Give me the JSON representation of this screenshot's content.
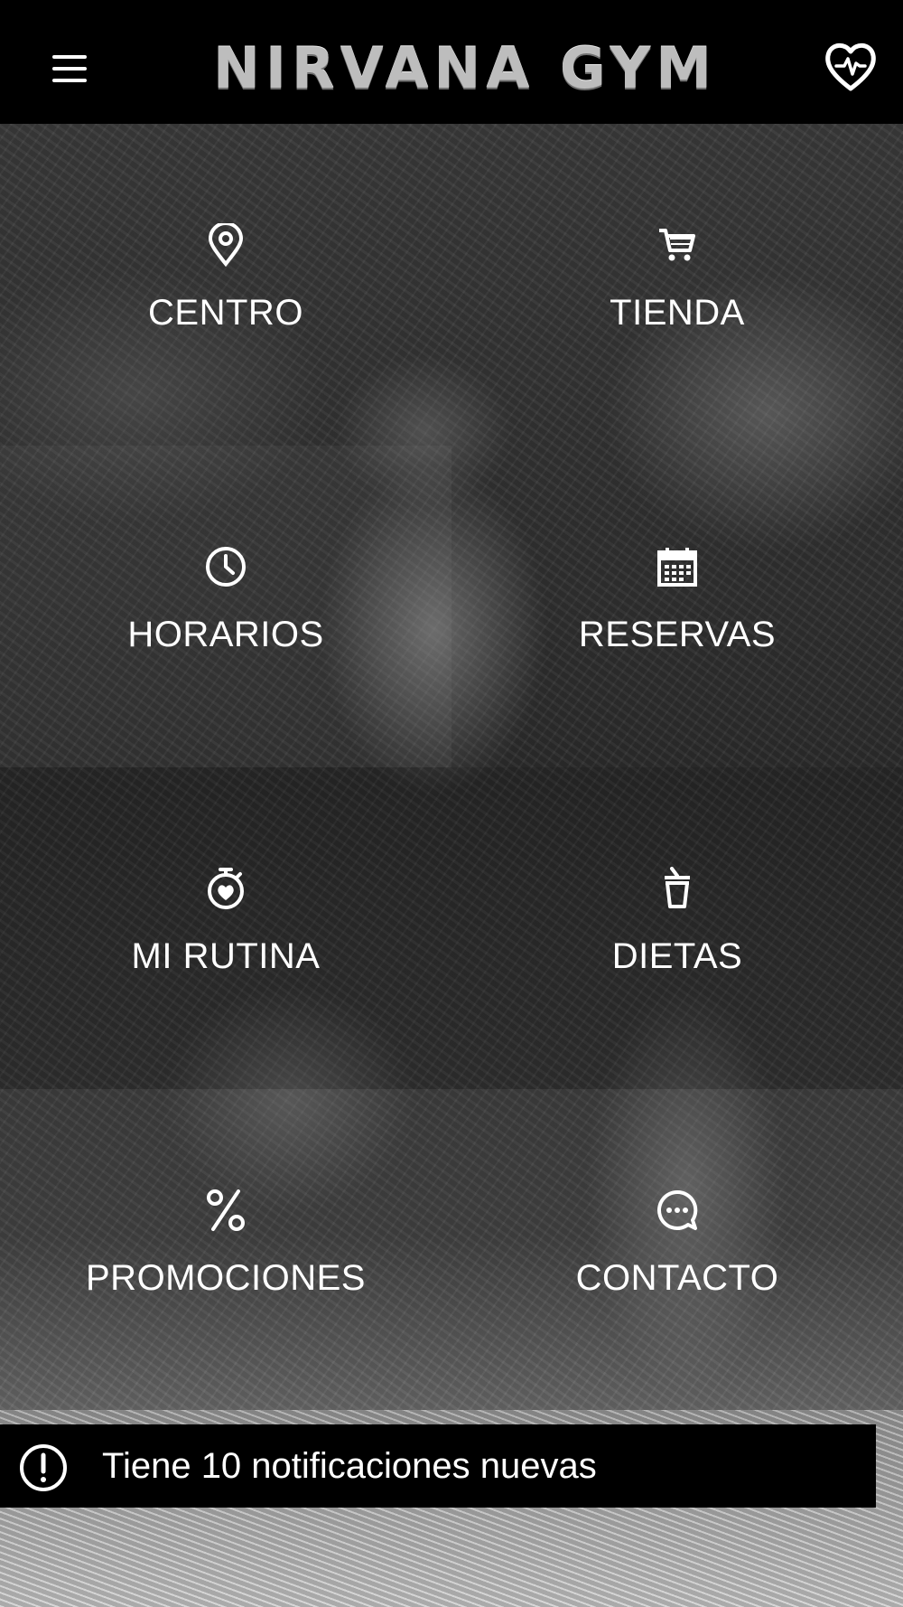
{
  "header": {
    "title": "NIRVANA GYM",
    "menu_icon": "hamburger-menu-icon",
    "favorite_icon": "heart-pulse-icon"
  },
  "tiles": [
    {
      "label": "CENTRO",
      "icon": "location-pin-icon"
    },
    {
      "label": "TIENDA",
      "icon": "shopping-cart-icon"
    },
    {
      "label": "HORARIOS",
      "icon": "clock-icon"
    },
    {
      "label": "RESERVAS",
      "icon": "calendar-icon"
    },
    {
      "label": "MI RUTINA",
      "icon": "stopwatch-heart-icon"
    },
    {
      "label": "DIETAS",
      "icon": "drink-cup-icon"
    },
    {
      "label": "PROMOCIONES",
      "icon": "percent-icon"
    },
    {
      "label": "CONTACTO",
      "icon": "chat-bubble-icon"
    }
  ],
  "notification": {
    "text": "Tiene 10 notificaciones nuevas",
    "icon": "alert-circle-icon"
  },
  "colors": {
    "header_bg": "#000000",
    "text": "#ffffff",
    "logo": "#bdbdbd"
  }
}
